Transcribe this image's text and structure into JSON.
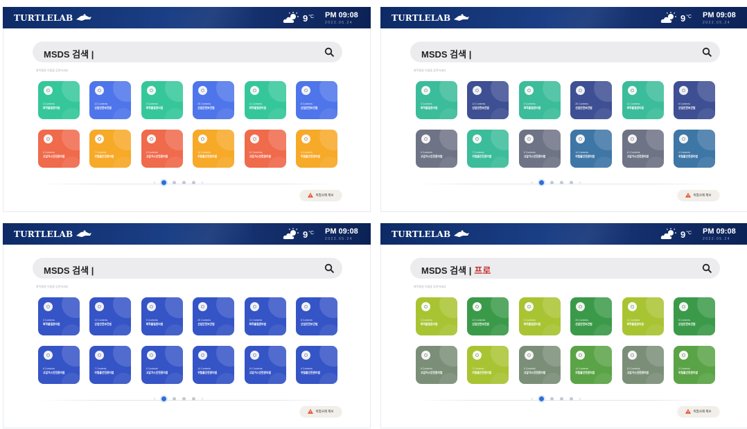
{
  "header": {
    "logo": "TURTLELAB",
    "temperature": "9",
    "temp_unit": "°C",
    "time": "PM 09:08",
    "date": "2022.05.24"
  },
  "search": {
    "label": "MSDS 검색",
    "cursor": "|"
  },
  "helper_text": "화학물질 이름을 입력하세요",
  "report_button": "위험사례 제보",
  "pager": {
    "pages": 4,
    "active": 1
  },
  "tile_titles": [
    {
      "count": "3 Contents",
      "name": "화학물질관리법"
    },
    {
      "count": "12 Contents",
      "name": "산업안전보건법"
    },
    {
      "count": "9 Contents",
      "name": "화학물질관리법"
    },
    {
      "count": "20 Contents",
      "name": "산업안전보건법"
    },
    {
      "count": "11 Contents",
      "name": "화학물질관리법"
    },
    {
      "count": "8 Contents",
      "name": "산업안전보건법"
    },
    {
      "count": "6 Contents",
      "name": "고압가스안전관리법"
    },
    {
      "count": "7 Contents",
      "name": "위험물안전관리법"
    },
    {
      "count": "5 Contents",
      "name": "고압가스안전관리법"
    },
    {
      "count": "14 Contents",
      "name": "위험물안전관리법"
    },
    {
      "count": "10 Contents",
      "name": "고압가스안전관리법"
    },
    {
      "count": "4 Contents",
      "name": "위험물안전관리법"
    }
  ],
  "panels": [
    {
      "typed": "",
      "colors": [
        "#35c79a",
        "#4f75ea",
        "#35c79a",
        "#4f75ea",
        "#35c79a",
        "#4f75ea",
        "#f06a4c",
        "#f7a928",
        "#f06a4c",
        "#f7a928",
        "#f06a4c",
        "#f7a928"
      ]
    },
    {
      "typed": "",
      "colors": [
        "#3bbc9a",
        "#3e4f93",
        "#3bbc9a",
        "#3e4f93",
        "#3bbc9a",
        "#3e4f93",
        "#6e7385",
        "#3bbc9a",
        "#6e7385",
        "#3e76a6",
        "#6e7385",
        "#3e76a6"
      ]
    },
    {
      "typed": "",
      "colors": [
        "#3554c6",
        "#3554c6",
        "#3554c6",
        "#3554c6",
        "#3554c6",
        "#3554c6",
        "#3554c6",
        "#3554c6",
        "#3554c6",
        "#3554c6",
        "#3554c6",
        "#3554c6"
      ]
    },
    {
      "typed": "프로",
      "colors": [
        "#a9c433",
        "#3b9a49",
        "#a9c433",
        "#3b9a49",
        "#a9c433",
        "#3b9a49",
        "#7b8f78",
        "#a9c433",
        "#7b8f78",
        "#5aa346",
        "#7b8f78",
        "#5aa346"
      ]
    }
  ]
}
